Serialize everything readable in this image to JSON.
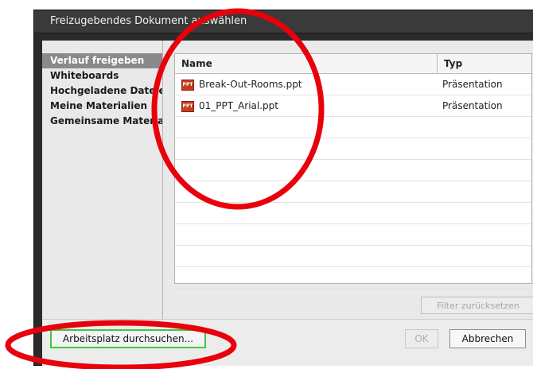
{
  "dialog": {
    "title": "Freizugebendes Dokument auswählen"
  },
  "sidebar": {
    "items": [
      {
        "label": "Verlauf freigeben",
        "selected": true
      },
      {
        "label": "Whiteboards"
      },
      {
        "label": "Hochgeladene Dateien"
      },
      {
        "label": "Meine Materialien"
      },
      {
        "label": "Gemeinsame Materialien"
      }
    ]
  },
  "table": {
    "columns": [
      "Name",
      "Typ"
    ],
    "rows": [
      {
        "name": "Break-Out-Rooms.ppt",
        "type": "Präsentation",
        "icon": "ppt-icon"
      },
      {
        "name": "01_PPT_Arial.ppt",
        "type": "Präsentation",
        "icon": "ppt-icon"
      }
    ]
  },
  "buttons": {
    "filter_reset": "Filter zurücksetzen",
    "browse": "Arbeitsplatz durchsuchen...",
    "ok": "OK",
    "cancel": "Abbrechen"
  },
  "colors": {
    "dialog_bg": "#2b2b2b",
    "annotation": "#e8000b",
    "highlight_border": "#3cc93c",
    "selected_bg": "#8a8a8a"
  }
}
